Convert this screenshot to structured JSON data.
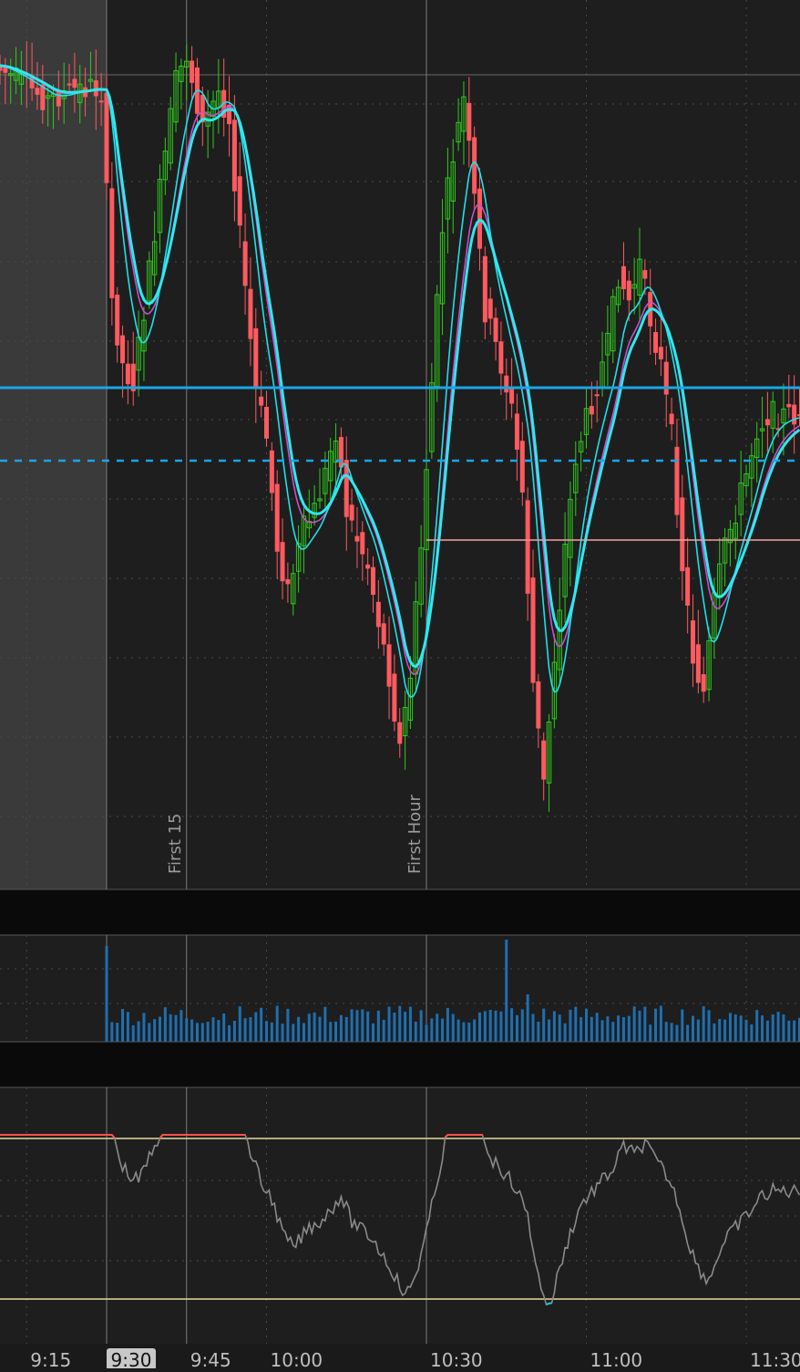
{
  "colors": {
    "background": "#1e1e1e",
    "premarket_shade": "#3a3a3a",
    "separator": "#0a0a0a",
    "grid": "#4a4a4a",
    "up_candle": "#2ecc1a",
    "down_candle": "#ff5a5f",
    "fast_ma": "#20e0e8",
    "slow_ma": "#2fe8ee",
    "vwap": "#c54fcc",
    "level_line": "#1aa6e6",
    "pink_level": "#f4a0a0",
    "volume": "#1f6fb0",
    "oscillator": "#8a8a8a",
    "osc_oversold": "#20c8e0",
    "osc_overbought": "#ff5050",
    "osc_band": "#e8d9a0",
    "axis_text": "#bfbfbf",
    "time_marker_bg": "#c8c8c8"
  },
  "chart_data": [
    {
      "type": "candlestick",
      "panel": "price",
      "x_unit": "time (2-minute bars)",
      "x_range": [
        "9:10",
        "11:32"
      ],
      "time_ticks": [
        "9:15",
        "9:30",
        "9:45",
        "10:00",
        "10:30",
        "11:00",
        "11:30"
      ],
      "vertical_markers": [
        {
          "time": "9:30",
          "label": ""
        },
        {
          "time": "9:45",
          "label": "First 15"
        },
        {
          "time": "10:30",
          "label": "First Hour"
        }
      ],
      "premarket_shaded_until": "9:30",
      "overlays": [
        "fast moving average",
        "slow moving average",
        "vwap"
      ],
      "horizontal_levels": [
        {
          "style": "solid",
          "color_key": "level_line"
        },
        {
          "style": "dashed",
          "color_key": "level_line"
        },
        {
          "style": "solid",
          "color_key": "pink_level",
          "from": "10:30"
        }
      ]
    },
    {
      "type": "bar",
      "panel": "volume",
      "x_range": [
        "9:10",
        "11:32"
      ]
    },
    {
      "type": "line",
      "panel": "oscillator",
      "x_range": [
        "9:10",
        "11:32"
      ],
      "bands": [
        "overbought",
        "oversold"
      ],
      "grid": true
    }
  ],
  "axis": {
    "time_labels": [
      "9:15",
      "9:30",
      "9:45",
      "10:00",
      "10:30",
      "11:00",
      "11:30"
    ],
    "highlighted_label": "9:30"
  },
  "markers": {
    "first15": "First 15",
    "first_hour": "First Hour"
  }
}
